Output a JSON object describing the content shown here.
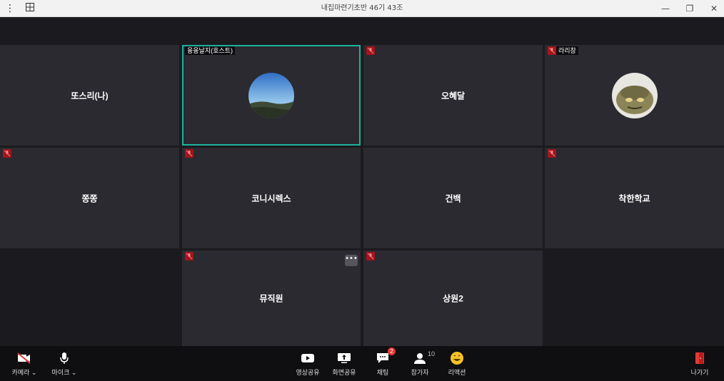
{
  "window": {
    "title": "내집마련기초반 46기 43조"
  },
  "tiles": {
    "t1": {
      "name": "또스리(나)"
    },
    "t2": {
      "tag": "융융날지(호스트)"
    },
    "t3": {
      "name": "오혜달"
    },
    "t4": {
      "tag": "라리창"
    },
    "t5": {
      "name": "쫑쫑"
    },
    "t6": {
      "name": "코니시렉스"
    },
    "t7": {
      "name": "건백"
    },
    "t8": {
      "name": "착한학교"
    },
    "t9": {
      "name": "뮤직원",
      "more": "•••"
    },
    "t10": {
      "name": "상원2"
    }
  },
  "toolbar": {
    "camera": "카메라 ⌄",
    "mic": "마이크 ⌄",
    "video_share": "영상공유",
    "screen_share": "화면공유",
    "chat": "채팅",
    "chat_badge": "2",
    "participants": "참가자",
    "participants_count": "10",
    "reaction": "리액션",
    "leave": "나가기"
  },
  "colors": {
    "active_border": "#1bb39a",
    "muted": "#a3141c",
    "leave": "#e53935"
  }
}
